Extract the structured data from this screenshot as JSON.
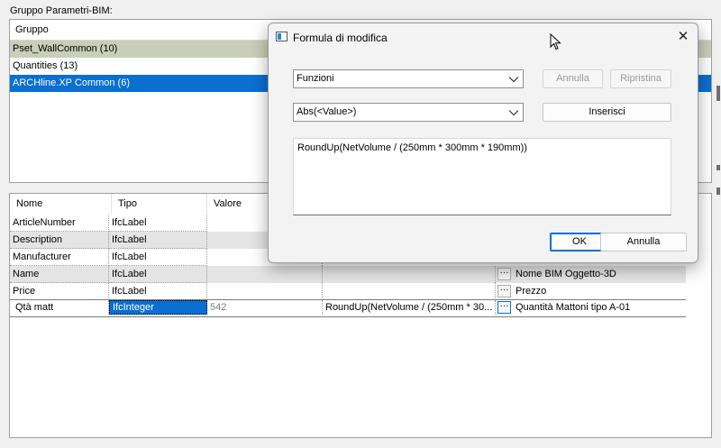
{
  "group_panel": {
    "label": "Gruppo Parametri-BIM:",
    "header": "Gruppo",
    "items": [
      {
        "label": "Pset_WallCommon (10)",
        "state": "selected-inactive"
      },
      {
        "label": "Quantities (13)",
        "state": "normal"
      },
      {
        "label": "ARCHline.XP Common (6)",
        "state": "selected"
      }
    ]
  },
  "param_table": {
    "headers": [
      "Nome",
      "Tipo",
      "Valore"
    ],
    "rows": [
      {
        "name": "ArticleNumber",
        "type": "IfcLabel",
        "value": "",
        "formula": "",
        "desc": ""
      },
      {
        "name": "Description",
        "type": "IfcLabel",
        "value": "",
        "formula": "",
        "desc": ""
      },
      {
        "name": "Manufacturer",
        "type": "IfcLabel",
        "value": "",
        "formula": "",
        "desc": ""
      },
      {
        "name": "Name",
        "type": "IfcLabel",
        "value": "",
        "formula": "",
        "desc": "Nome BIM Oggetto-3D"
      },
      {
        "name": "Price",
        "type": "IfcLabel",
        "value": "",
        "formula": "",
        "desc": "Prezzo"
      },
      {
        "name": "Qtà matt",
        "type": "IfcInteger",
        "value": "542",
        "formula": "RoundUp(NetVolume / (250mm * 30...",
        "desc": "Quantità Mattoni tipo A-01"
      }
    ],
    "ellipsis_label": "···"
  },
  "dialog": {
    "title": "Formula di modifica",
    "close_glyph": "✕",
    "category_combo": "Funzioni",
    "function_combo": "Abs(<Value>)",
    "undo_label": "Annulla",
    "redo_label": "Ripristina",
    "insert_label": "Inserisci",
    "formula_text": "RoundUp(NetVolume / (250mm * 300mm * 190mm))",
    "ok_label": "OK",
    "cancel_label": "Annulla"
  },
  "colors": {
    "selection_blue": "#0a6fd1",
    "selection_gray": "#c9ceb8"
  }
}
